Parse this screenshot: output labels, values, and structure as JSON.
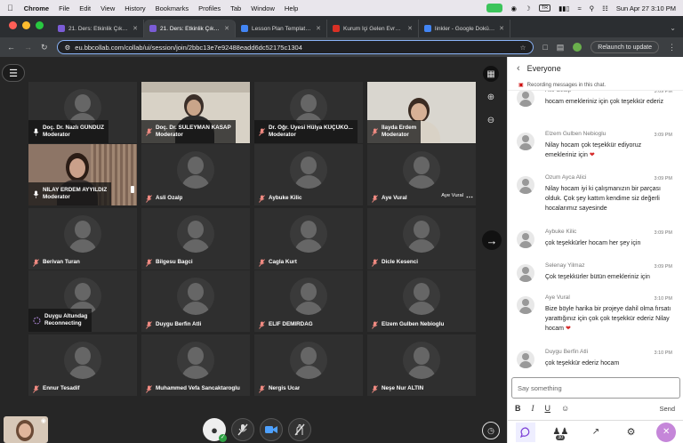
{
  "menubar": {
    "app": "Chrome",
    "items": [
      "File",
      "Edit",
      "View",
      "History",
      "Bookmarks",
      "Profiles",
      "Tab",
      "Window",
      "Help"
    ],
    "datetime": "Sun Apr 27  3:10 PM",
    "input_source": "TR"
  },
  "tabs": [
    {
      "title": "21. Ders: Etkinlik Çıktılarının S",
      "favicon_color": "#7b5cd6",
      "active": false
    },
    {
      "title": "21. Ders: Etkinlik Çıktılarını",
      "favicon_color": "#7b5cd6",
      "active": true
    },
    {
      "title": "Lesson Plan Templates for Gr",
      "favicon_color": "#4285f4",
      "active": false
    },
    {
      "title": "Kurum İçi Gelen Evrak Görün",
      "favicon_color": "#d93025",
      "active": false
    },
    {
      "title": "linkler - Google Dokümanlar",
      "favicon_color": "#4285f4",
      "active": false
    }
  ],
  "address": {
    "url": "eu.bbcollab.com/collab/ui/session/join/2bbc13e7e92488eadd6dc52175c1304",
    "relaunch": "Relaunch to update"
  },
  "participants": [
    {
      "name": "Doç. Dr. Nazlı GÜNDÜZ",
      "role": "Moderator",
      "muted": false,
      "video": false
    },
    {
      "name": "Doç. Dr. SÜLEYMAN KASAP",
      "role": "Moderator",
      "muted": true,
      "video": true
    },
    {
      "name": "Dr. Öğr. Üyesi Hülya KÜÇÜKO...",
      "role": "Moderator",
      "muted": true,
      "video": false
    },
    {
      "name": "İlayda Erdem",
      "role": "Moderator",
      "muted": true,
      "video": true
    },
    {
      "name": "NİLAY ERDEM AYYILDIZ",
      "role": "Moderator",
      "muted": false,
      "video": true
    },
    {
      "name": "Asli Ozalp",
      "role": "",
      "muted": true,
      "video": false
    },
    {
      "name": "Aybuke Kilic",
      "role": "",
      "muted": true,
      "video": false
    },
    {
      "name": "Aye Vural",
      "role": "",
      "muted": true,
      "video": false,
      "tooltip": "Aye Vural"
    },
    {
      "name": "Berivan Turan",
      "role": "",
      "muted": true,
      "video": false
    },
    {
      "name": "Bilgesu Bagci",
      "role": "",
      "muted": true,
      "video": false
    },
    {
      "name": "Cagla Kurt",
      "role": "",
      "muted": true,
      "video": false
    },
    {
      "name": "Dicle Kesenci",
      "role": "",
      "muted": true,
      "video": false
    },
    {
      "name": "Duygu Altundag",
      "role": "Reconnecting",
      "muted": false,
      "video": false,
      "reconnecting": true
    },
    {
      "name": "Duygu Berfin Atli",
      "role": "",
      "muted": true,
      "video": false
    },
    {
      "name": "ELIF DEMIRDAG",
      "role": "",
      "muted": true,
      "video": false
    },
    {
      "name": "Elzem Gulben Nebioglu",
      "role": "",
      "muted": true,
      "video": false
    },
    {
      "name": "Ennur Tesadif",
      "role": "",
      "muted": true,
      "video": false
    },
    {
      "name": "Muhammed Vefa Sancaktaroglu",
      "role": "",
      "muted": true,
      "video": false
    },
    {
      "name": "Nergis Ucar",
      "role": "",
      "muted": true,
      "video": false
    },
    {
      "name": "Neşe Nur ALTIN",
      "role": "",
      "muted": true,
      "video": false
    }
  ],
  "chat": {
    "title": "Everyone",
    "recording": "Recording messages in this chat.",
    "messages": [
      {
        "author": "Asli Ozalp",
        "time": "3:09 PM",
        "text": "hocam emekleriniz için çok teşekkür ederiz"
      },
      {
        "author": "Elzem Gulben Nebioglu",
        "time": "3:09 PM",
        "text": "Nilay hocam çok teşekkür ediyoruz emekleriniz için",
        "heart": true
      },
      {
        "author": "Ozum Ayca Alici",
        "time": "3:09 PM",
        "text": "Nilay hocam iyi ki çalışmanızın bir parçası olduk. Çok şey kattım kendime siz değerli hocalarımız sayesinde"
      },
      {
        "author": "Aybuke Kilic",
        "time": "3:09 PM",
        "text": "çok teşekkürler hocam her şey için"
      },
      {
        "author": "Selenay Yilmaz",
        "time": "3:09 PM",
        "text": "Çok teşekkürler bütün emekleriniz için"
      },
      {
        "author": "Aye Vural",
        "time": "3:10 PM",
        "text": "Bize böyle harika bir projeye dahil olma fırsatı yarattığınız için çok çok teşekkür ederiz Nilay hocam",
        "heart": true
      },
      {
        "author": "Duygu Berfin Atli",
        "time": "3:10 PM",
        "text": "çok teşekkür ederiz hocam"
      }
    ],
    "placeholder": "Say something",
    "send": "Send",
    "participant_count": "30"
  },
  "colors": {
    "accent": "#8ab4f8",
    "chat_bg": "#ffffff",
    "stage_bg": "#262626",
    "heart": "#d62b2b"
  }
}
